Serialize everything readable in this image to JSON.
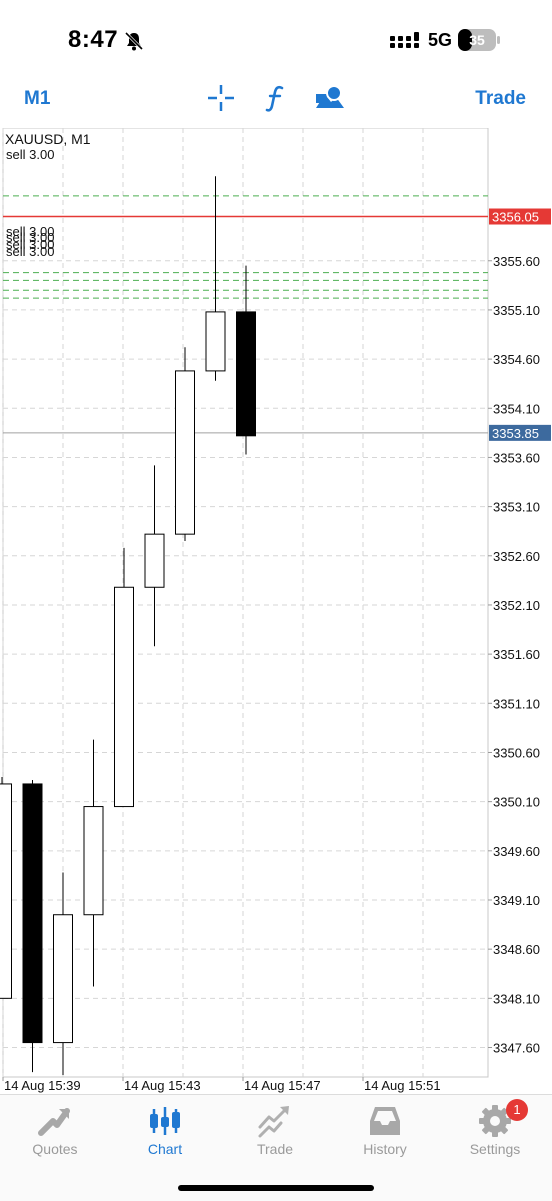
{
  "status_bar": {
    "time": "8:47",
    "network": "5G",
    "battery": "35"
  },
  "toolbar": {
    "period_label": "M1",
    "trade_label": "Trade",
    "icons": [
      "crosshair-icon",
      "indicator-f-icon",
      "objects-icon"
    ],
    "accent_color": "#1f78d1"
  },
  "chart": {
    "symbol_label": "XAUUSD, M1",
    "order_labels": [
      "sell 3.00",
      "sell 3.00",
      "sell 3.00",
      "sell 3.00",
      "sell 3.00"
    ],
    "ask_price": "3356.05",
    "bid_price": "3353.85",
    "ask_color": "#e53935",
    "bid_color": "#3d6a9e",
    "order_line_color": "#4caf50"
  },
  "chart_data": {
    "type": "candlestick",
    "title": "XAUUSD, M1",
    "ylim": [
      3347.3,
      3356.95
    ],
    "y_tick_labels": [
      "3355.60",
      "3355.10",
      "3354.60",
      "3354.10",
      "3353.60",
      "3353.10",
      "3352.60",
      "3352.10",
      "3351.60",
      "3351.10",
      "3350.60",
      "3350.10",
      "3349.60",
      "3349.10",
      "3348.60",
      "3348.10",
      "3347.60"
    ],
    "x_tick_labels": [
      "14 Aug 15:39",
      "14 Aug 15:43",
      "14 Aug 15:47",
      "14 Aug 15:51"
    ],
    "ask_level": 3356.05,
    "bid_level": 3353.85,
    "sell_order_levels": [
      3356.26,
      3355.48,
      3355.4,
      3355.3,
      3355.22
    ],
    "candles": [
      {
        "open": 3348.1,
        "high": 3350.35,
        "low": 3348.1,
        "close": 3350.28
      },
      {
        "open": 3350.28,
        "high": 3350.32,
        "low": 3347.35,
        "close": 3347.65
      },
      {
        "open": 3347.65,
        "high": 3349.38,
        "low": 3347.32,
        "close": 3348.95
      },
      {
        "open": 3348.95,
        "high": 3350.73,
        "low": 3348.22,
        "close": 3350.05
      },
      {
        "open": 3350.05,
        "high": 3352.68,
        "low": 3350.05,
        "close": 3352.28
      },
      {
        "open": 3352.28,
        "high": 3353.52,
        "low": 3351.68,
        "close": 3352.82
      },
      {
        "open": 3352.82,
        "high": 3354.72,
        "low": 3352.75,
        "close": 3354.48
      },
      {
        "open": 3354.48,
        "high": 3356.46,
        "low": 3354.38,
        "close": 3355.08
      },
      {
        "open": 3355.08,
        "high": 3355.55,
        "low": 3353.63,
        "close": 3353.82
      }
    ]
  },
  "tab_bar": {
    "tabs": [
      {
        "label": "Quotes",
        "icon": "quotes-icon",
        "active": false
      },
      {
        "label": "Chart",
        "icon": "chart-icon",
        "active": true
      },
      {
        "label": "Trade",
        "icon": "trade-icon",
        "active": false
      },
      {
        "label": "History",
        "icon": "history-icon",
        "active": false
      },
      {
        "label": "Settings",
        "icon": "settings-icon",
        "active": false,
        "badge": "1"
      }
    ]
  }
}
